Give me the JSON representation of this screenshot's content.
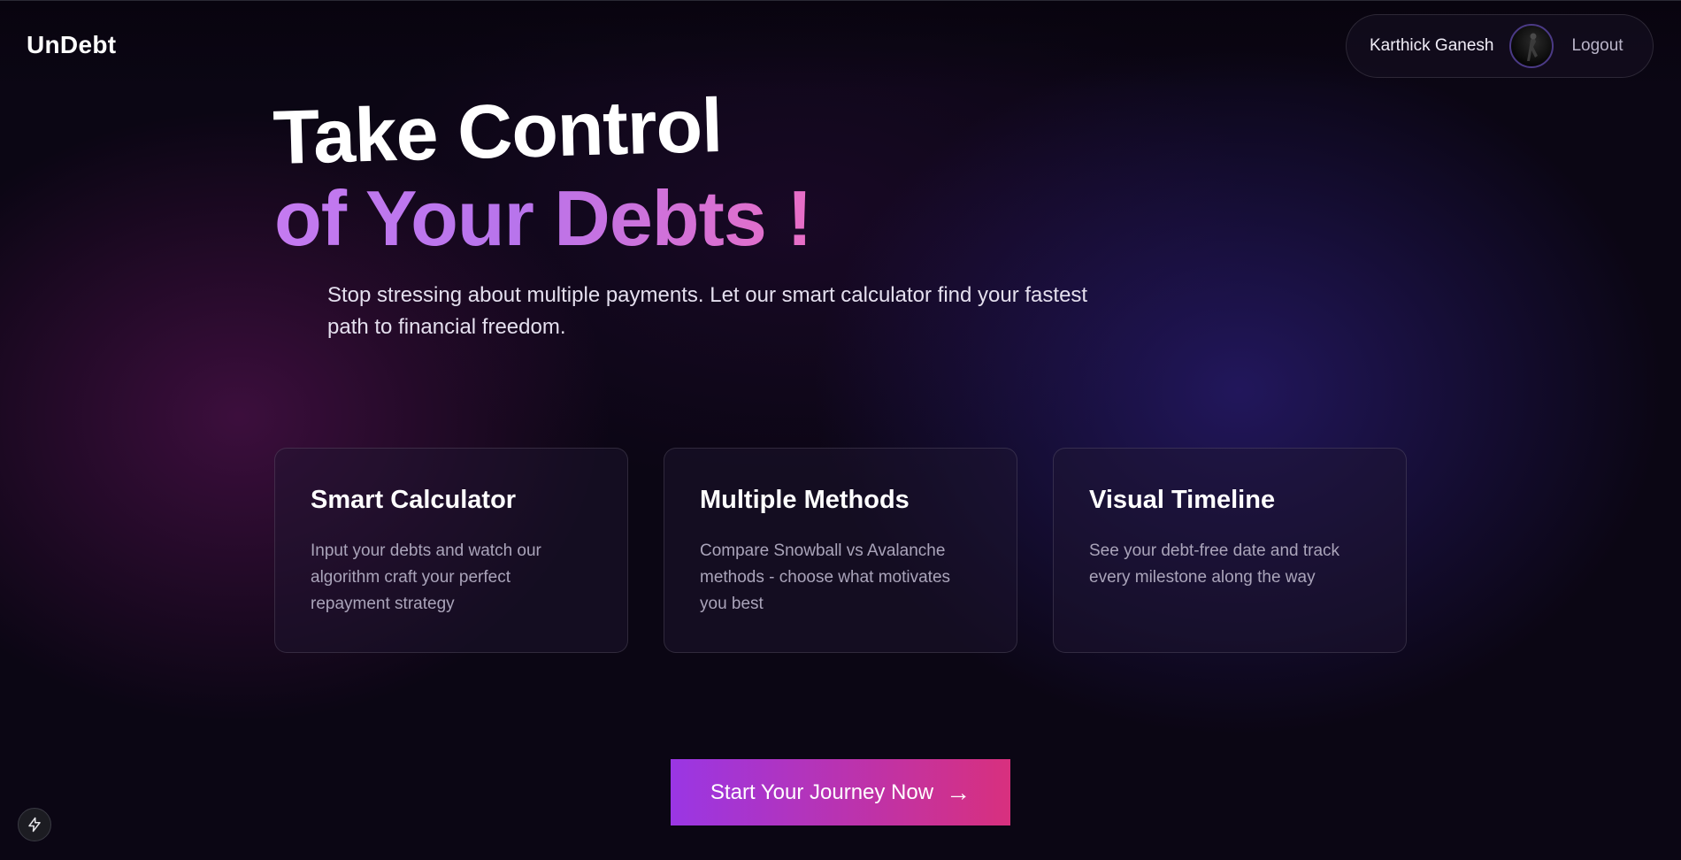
{
  "header": {
    "brand": "UnDebt",
    "user_name": "Karthick Ganesh",
    "logout_label": "Logout"
  },
  "hero": {
    "title_line1": "Take Control",
    "title_line2": "of Your Debts !",
    "subtitle": "Stop stressing about multiple payments. Let our smart calculator find your fastest path to financial freedom."
  },
  "features": [
    {
      "title": "Smart Calculator",
      "description": "Input your debts and watch our algorithm craft your perfect repayment strategy"
    },
    {
      "title": "Multiple Methods",
      "description": "Compare Snowball vs Avalanche methods - choose what motivates you best"
    },
    {
      "title": "Visual Timeline",
      "description": "See your debt-free date and track every milestone along the way"
    }
  ],
  "cta": {
    "label": "Start Your Journey Now",
    "arrow": "→"
  },
  "icons": {
    "avatar": "user-avatar",
    "devtools": "lightning-bolt-icon"
  },
  "colors": {
    "background": "#0b0614",
    "accent_purple": "#9a36e4",
    "accent_pink": "#d8307e",
    "heading_gradient_start": "#c47af0",
    "heading_gradient_end": "#e86ec6"
  }
}
